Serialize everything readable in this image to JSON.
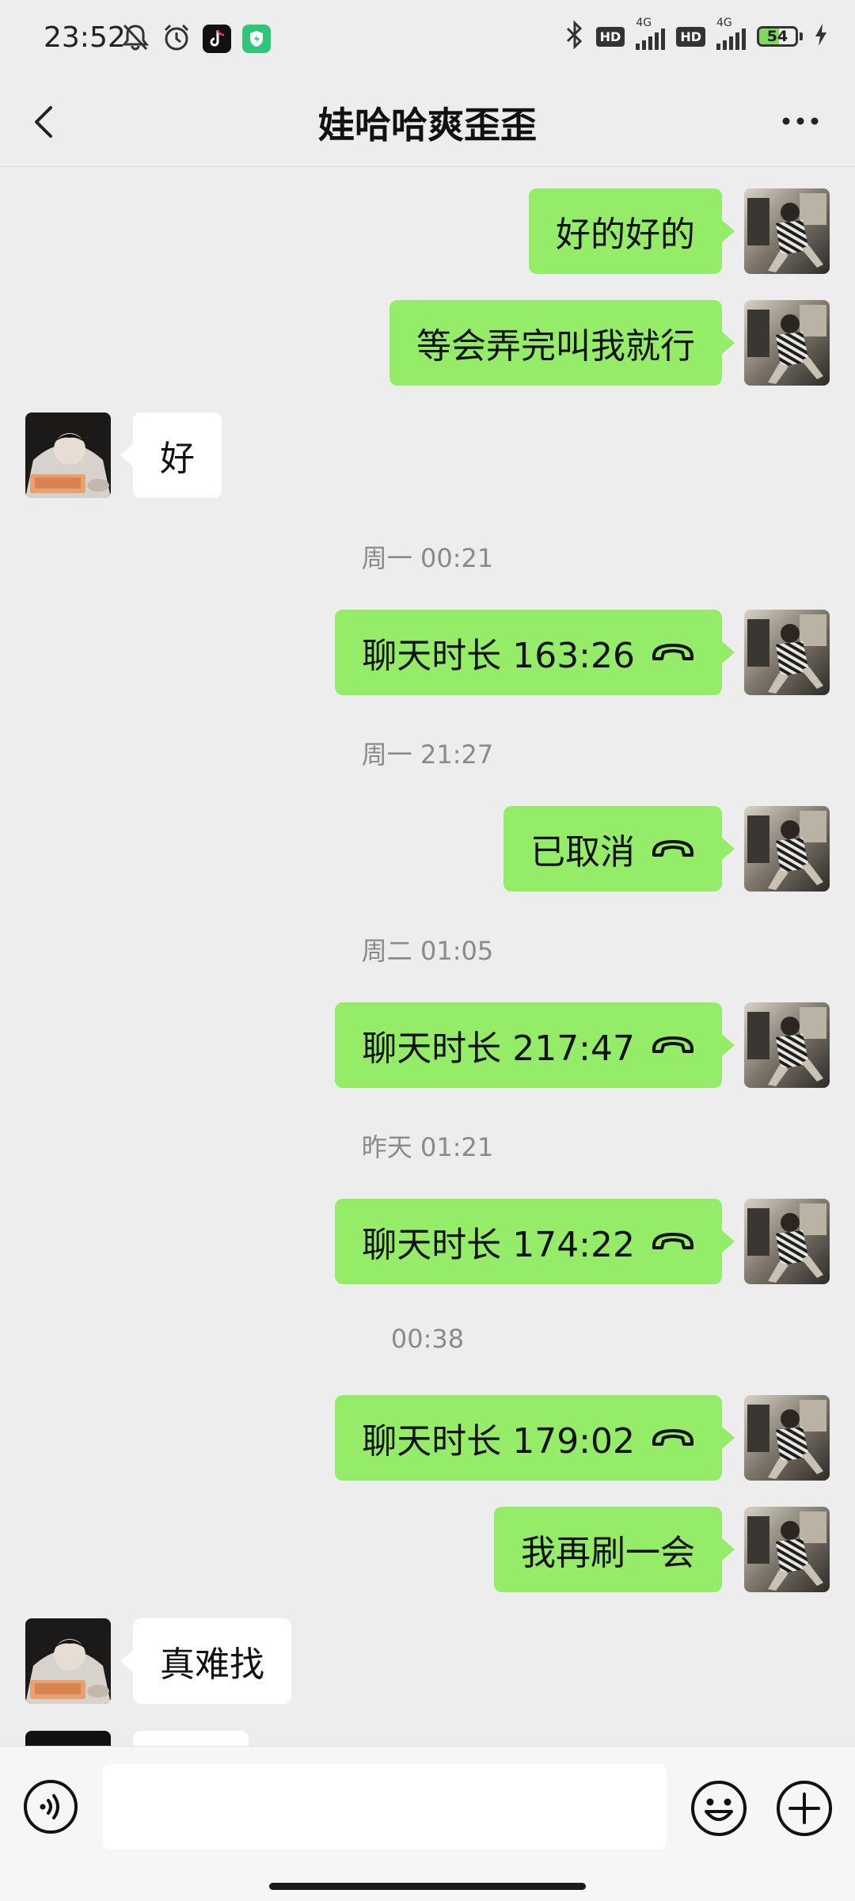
{
  "status_bar": {
    "time": "23:52",
    "icons_left": [
      "mute-bell-icon",
      "alarm-icon",
      "tiktok-app-icon",
      "security-app-icon"
    ],
    "icons_right": [
      "bluetooth-icon",
      "hd-icon",
      "signal-icon",
      "hd-icon",
      "signal-icon",
      "battery-icon",
      "charging-icon"
    ],
    "hd_label": "HD",
    "network_label": "4G",
    "battery_level": "54"
  },
  "header": {
    "title": "娃哈哈爽歪歪",
    "back_icon": "chevron-left-icon",
    "more_icon": "more-icon"
  },
  "messages": [
    {
      "side": "right",
      "text": "好的好的"
    },
    {
      "side": "right",
      "text": "等会弄完叫我就行"
    },
    {
      "side": "left",
      "text": "好"
    },
    {
      "timestamp": "周一 00:21"
    },
    {
      "side": "right",
      "text": "聊天时长 163:26",
      "call": true
    },
    {
      "timestamp": "周一 21:27"
    },
    {
      "side": "right",
      "text": "已取消",
      "call": true
    },
    {
      "timestamp": "周二 01:05"
    },
    {
      "side": "right",
      "text": "聊天时长 217:47",
      "call": true
    },
    {
      "timestamp": "昨天 01:21"
    },
    {
      "side": "right",
      "text": "聊天时长 174:22",
      "call": true
    },
    {
      "timestamp": "00:38"
    },
    {
      "side": "right",
      "text": "聊天时长 179:02",
      "call": true
    },
    {
      "side": "right",
      "text": "我再刷一会"
    },
    {
      "side": "left",
      "text": "真难找"
    }
  ],
  "input_bar": {
    "placeholder": "",
    "voice_icon": "voice-icon",
    "emoji_icon": "emoji-icon",
    "plus_icon": "plus-icon"
  },
  "colors": {
    "background": "#ededed",
    "sent_bubble": "#95ec69",
    "received_bubble": "#ffffff",
    "timestamp_text": "#8a8a8a"
  }
}
